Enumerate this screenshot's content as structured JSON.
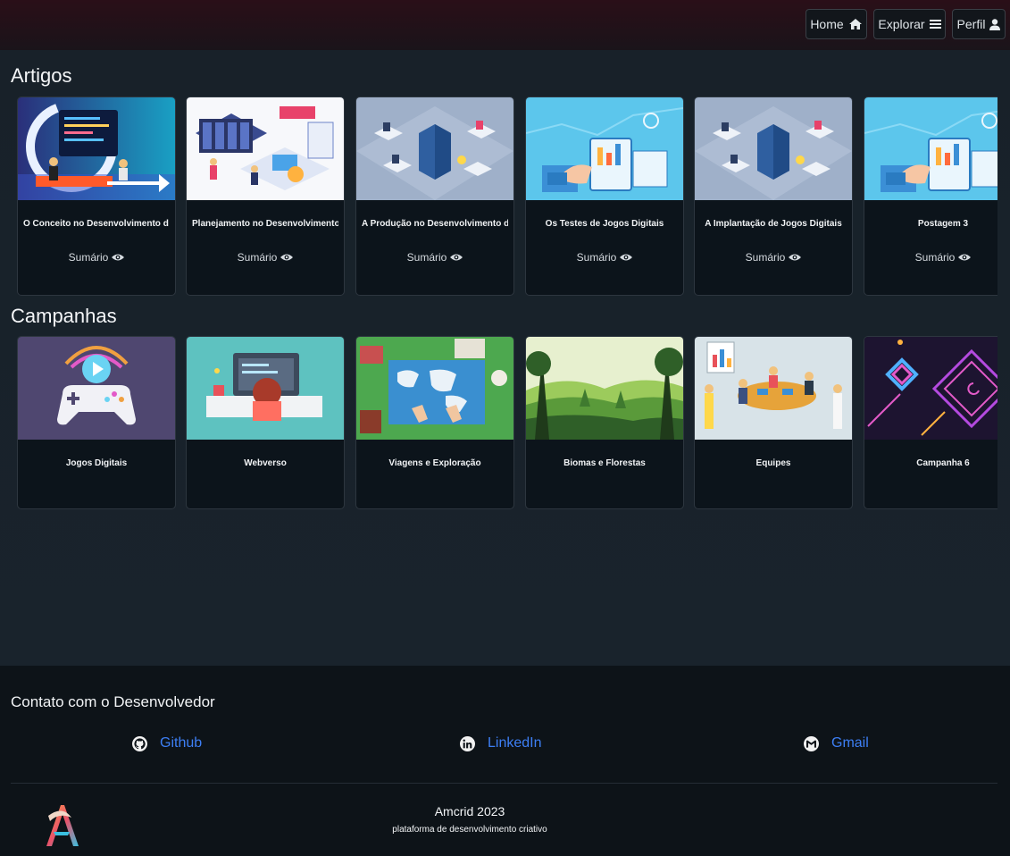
{
  "nav": {
    "home_label": "Home",
    "explore_label": "Explorar",
    "profile_label": "Perfil"
  },
  "articles": {
    "heading": "Artigos",
    "summary_label": "Sumário",
    "items": [
      {
        "title": "O Conceito no Desenvolvimento d"
      },
      {
        "title": "Planejamento no Desenvolvimento"
      },
      {
        "title": "A Produção no Desenvolvimento d"
      },
      {
        "title": "Os Testes de Jogos Digitais"
      },
      {
        "title": "A Implantação de Jogos Digitais"
      },
      {
        "title": "Postagem 3"
      }
    ]
  },
  "campaigns": {
    "heading": "Campanhas",
    "items": [
      {
        "title": "Jogos Digitais"
      },
      {
        "title": "Webverso"
      },
      {
        "title": "Viagens e Exploração"
      },
      {
        "title": "Biomas e Florestas"
      },
      {
        "title": "Equipes"
      },
      {
        "title": "Campanha 6"
      }
    ]
  },
  "footer": {
    "heading": "Contato com o Desenvolvedor",
    "contacts": [
      {
        "label": "Github",
        "icon": "github-icon"
      },
      {
        "label": "LinkedIn",
        "icon": "linkedin-icon"
      },
      {
        "label": "Gmail",
        "icon": "gmail-icon"
      }
    ],
    "brand_name": "Amcrid 2023",
    "tagline": "plataforma de desenvolvimento criativo"
  },
  "colors": {
    "background": "#161f27",
    "card": "#0c141b",
    "link": "#3d7ff5",
    "header": "#2a0f18"
  }
}
